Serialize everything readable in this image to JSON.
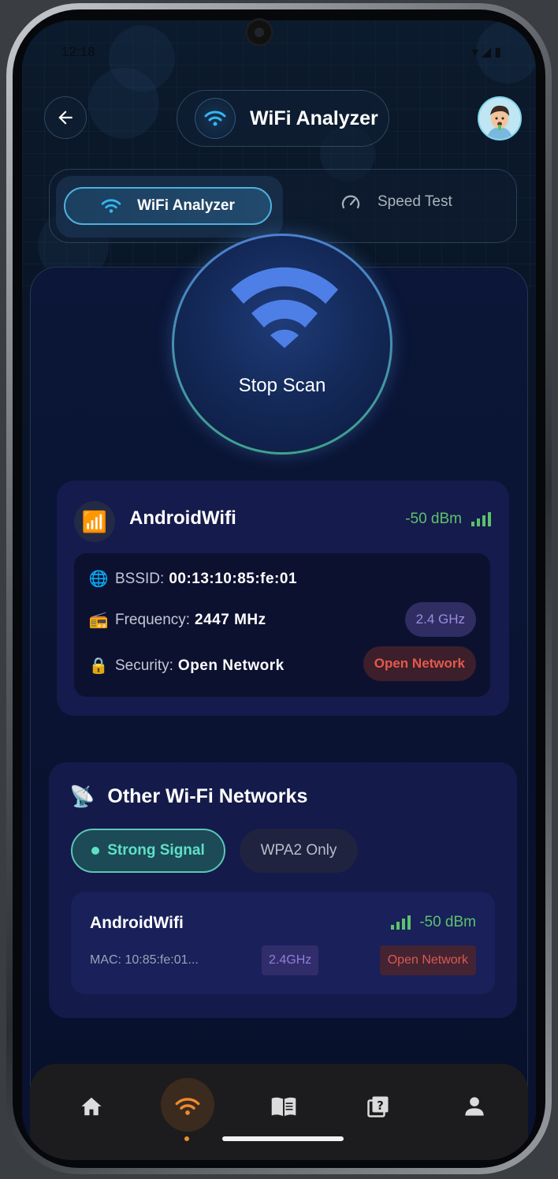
{
  "status_bar": {
    "time": "12:18",
    "icons": "▾◢▮"
  },
  "header": {
    "title": "WiFi Analyzer",
    "back_icon": "arrow-left-icon",
    "avatar_icon": "user-avatar-icon"
  },
  "tabs": [
    {
      "label": "WiFi Analyzer",
      "icon": "wifi-icon",
      "active": true
    },
    {
      "label": "Speed Test",
      "icon": "speedometer-icon",
      "active": false
    }
  ],
  "scan_button": {
    "label": "Stop Scan",
    "icon": "wifi-icon"
  },
  "connected_network": {
    "icon": "📶",
    "name": "AndroidWifi",
    "signal": "-50 dBm",
    "bssid_icon": "🌐",
    "bssid_label": "BSSID:",
    "bssid_value": "00:13:10:85:fe:01",
    "frequency_icon": "📻",
    "frequency_label": "Frequency:",
    "frequency_value": "2447 MHz",
    "band_badge": "2.4 GHz",
    "security_icon": "🔒",
    "security_label": "Security:",
    "security_value": "Open Network",
    "security_badge": "Open Network"
  },
  "other_networks": {
    "icon": "📡",
    "title": "Other Wi-Fi Networks",
    "filters": [
      {
        "label": "Strong Signal",
        "active": true
      },
      {
        "label": "WPA2 Only",
        "active": false
      }
    ],
    "items": [
      {
        "name": "AndroidWifi",
        "signal": "-50 dBm",
        "mac": "MAC: 10:85:fe:01...",
        "band": "2.4GHz",
        "security": "Open Network"
      }
    ]
  },
  "bottom_nav": [
    {
      "icon": "home-icon",
      "active": false
    },
    {
      "icon": "wifi-icon",
      "active": true
    },
    {
      "icon": "book-icon",
      "active": false
    },
    {
      "icon": "quiz-icon",
      "active": false
    },
    {
      "icon": "person-icon",
      "active": false
    }
  ],
  "colors": {
    "accent_blue": "#4fb0dd",
    "signal_green": "#5bc26a",
    "open_red": "#e35a4a",
    "band_purple": "#9b8ce0",
    "nav_active_orange": "#f08a2c"
  }
}
